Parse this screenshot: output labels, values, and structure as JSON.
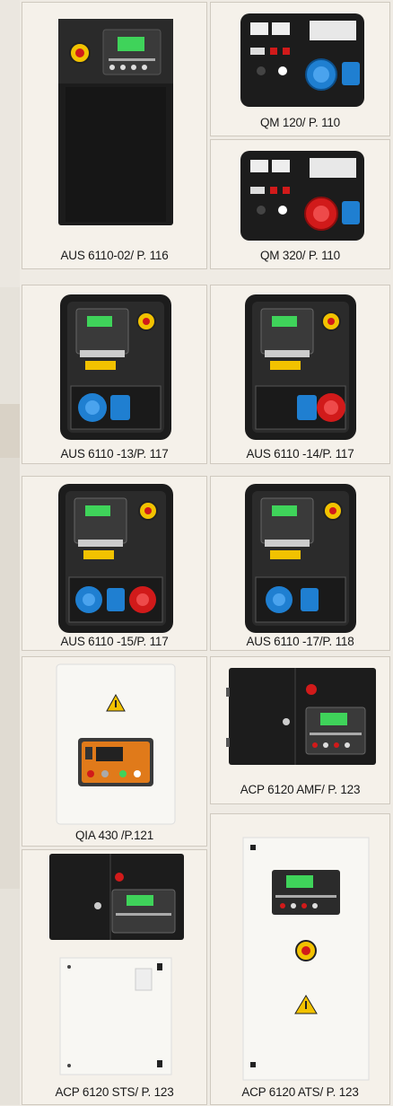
{
  "captions": {
    "aus_6110_02": "AUS 6110-02/ P. 116",
    "qm_120": "QM 120/ P. 110",
    "qm_320": "QM 320/ P. 110",
    "aus_6110_13": "AUS 6110 -13/P. 117",
    "aus_6110_14": "AUS 6110 -14/P. 117",
    "aus_6110_15": "AUS 6110 -15/P. 117",
    "aus_6110_17": "AUS 6110 -17/P. 118",
    "qia_430": "QIA 430 /P.121",
    "acp_6120_amf": "ACP 6120 AMF/ P. 123",
    "acp_6120_sts": "ACP 6120 STS/ P. 123",
    "acp_6120_ats": "ACP 6120 ATS/ P. 123"
  },
  "colors": {
    "panel_dark": "#1c1c1c",
    "panel_grey": "#3a3a3a",
    "socket_blue": "#1f7fd1",
    "socket_red": "#d11a1a",
    "estop_yellow": "#f2c200",
    "display_green": "#3fd35a",
    "caption_bg": "#f5f1ea"
  }
}
